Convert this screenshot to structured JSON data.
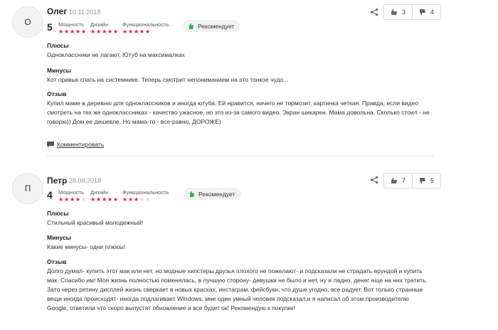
{
  "reviews": [
    {
      "initial": "О",
      "author": "Олег",
      "date": "10.11.2018",
      "score": "5",
      "criteria": [
        {
          "label": "Мощность",
          "stars": 5
        },
        {
          "label": "Дизайн",
          "stars": 5
        },
        {
          "label": "Функциональность",
          "stars": 5
        }
      ],
      "badge": "Рекомендует",
      "likes": "3",
      "dislikes": "4",
      "plus_title": "Плюсы",
      "plus_text": "Одноклассники не лагают. Ютуб на максималках",
      "minus_title": "Минусы",
      "minus_text": "Кот привык спать на системнике. Теперь смотрит непониманием на это тонкое чудо...",
      "review_title": "Отзыв",
      "review_text": "Купил маме в деревню для одноклассников и иногда ютуба. Ей нравится, ничего не тормозит, картинка четкая. Правда, если видео смотреть на тех же одноклассниках - качество ужасное, но это из-за самого видео. Экран шикарен. Мама довольна. Сколько стоил - не говорю)) Дом ее дешевле. Но мама-то - все-равно, ДОРОЖЕ)",
      "comment_label": "Комментировать"
    },
    {
      "initial": "П",
      "author": "Петр",
      "date": "28.08.2018",
      "score": "4",
      "criteria": [
        {
          "label": "Мощность",
          "stars": 4
        },
        {
          "label": "Дизайн",
          "stars": 5
        },
        {
          "label": "Функциональность",
          "stars": 3
        }
      ],
      "badge": "Рекомендует",
      "likes": "7",
      "dislikes": "5",
      "plus_title": "Плюсы",
      "plus_text": "Стильный красивый молодежный!",
      "minus_title": "Минусы",
      "minus_text": "Какие минусы- одни плюсы!",
      "review_title": "Отзыв",
      "review_text": "Долго думал- купить этот мак или нет, но модные хипстеры друзья плохого не пожелают- и подсказали не страдать ерундой и купить мак. Спасибо им! Моя жизнь полностью поменялась, в лучшую сторону- девушки не было и нет, ну и ладно, денег еще на них тратить. Зато через ретину дисплей жизнь сверкает в новых красках, инстаграм, фейсбуки, что душе угодно, все радует. Вот только странные вещи иногда происходят- иногда подлагивает Windows, мне один умный человек подсказал,и я написал об этом производителю Google, ответили что скоро выпустят обновление и все будет ок! Рекомендую к покупке!"
    }
  ],
  "colors": {
    "star_active": "#e5173f",
    "star_inactive": "#d9d9d9",
    "recommend_icon": "#2fb24c"
  }
}
